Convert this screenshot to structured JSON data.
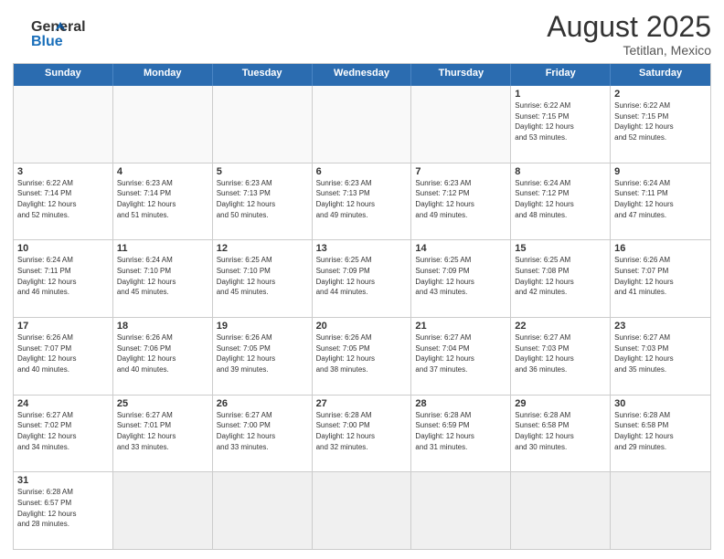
{
  "header": {
    "logo_general": "General",
    "logo_blue": "Blue",
    "month_year": "August 2025",
    "location": "Tetitlan, Mexico"
  },
  "days_of_week": [
    "Sunday",
    "Monday",
    "Tuesday",
    "Wednesday",
    "Thursday",
    "Friday",
    "Saturday"
  ],
  "weeks": [
    [
      {
        "day": "",
        "info": ""
      },
      {
        "day": "",
        "info": ""
      },
      {
        "day": "",
        "info": ""
      },
      {
        "day": "",
        "info": ""
      },
      {
        "day": "",
        "info": ""
      },
      {
        "day": "1",
        "info": "Sunrise: 6:22 AM\nSunset: 7:15 PM\nDaylight: 12 hours\nand 53 minutes."
      },
      {
        "day": "2",
        "info": "Sunrise: 6:22 AM\nSunset: 7:15 PM\nDaylight: 12 hours\nand 52 minutes."
      }
    ],
    [
      {
        "day": "3",
        "info": "Sunrise: 6:22 AM\nSunset: 7:14 PM\nDaylight: 12 hours\nand 52 minutes."
      },
      {
        "day": "4",
        "info": "Sunrise: 6:23 AM\nSunset: 7:14 PM\nDaylight: 12 hours\nand 51 minutes."
      },
      {
        "day": "5",
        "info": "Sunrise: 6:23 AM\nSunset: 7:13 PM\nDaylight: 12 hours\nand 50 minutes."
      },
      {
        "day": "6",
        "info": "Sunrise: 6:23 AM\nSunset: 7:13 PM\nDaylight: 12 hours\nand 49 minutes."
      },
      {
        "day": "7",
        "info": "Sunrise: 6:23 AM\nSunset: 7:12 PM\nDaylight: 12 hours\nand 49 minutes."
      },
      {
        "day": "8",
        "info": "Sunrise: 6:24 AM\nSunset: 7:12 PM\nDaylight: 12 hours\nand 48 minutes."
      },
      {
        "day": "9",
        "info": "Sunrise: 6:24 AM\nSunset: 7:11 PM\nDaylight: 12 hours\nand 47 minutes."
      }
    ],
    [
      {
        "day": "10",
        "info": "Sunrise: 6:24 AM\nSunset: 7:11 PM\nDaylight: 12 hours\nand 46 minutes."
      },
      {
        "day": "11",
        "info": "Sunrise: 6:24 AM\nSunset: 7:10 PM\nDaylight: 12 hours\nand 45 minutes."
      },
      {
        "day": "12",
        "info": "Sunrise: 6:25 AM\nSunset: 7:10 PM\nDaylight: 12 hours\nand 45 minutes."
      },
      {
        "day": "13",
        "info": "Sunrise: 6:25 AM\nSunset: 7:09 PM\nDaylight: 12 hours\nand 44 minutes."
      },
      {
        "day": "14",
        "info": "Sunrise: 6:25 AM\nSunset: 7:09 PM\nDaylight: 12 hours\nand 43 minutes."
      },
      {
        "day": "15",
        "info": "Sunrise: 6:25 AM\nSunset: 7:08 PM\nDaylight: 12 hours\nand 42 minutes."
      },
      {
        "day": "16",
        "info": "Sunrise: 6:26 AM\nSunset: 7:07 PM\nDaylight: 12 hours\nand 41 minutes."
      }
    ],
    [
      {
        "day": "17",
        "info": "Sunrise: 6:26 AM\nSunset: 7:07 PM\nDaylight: 12 hours\nand 40 minutes."
      },
      {
        "day": "18",
        "info": "Sunrise: 6:26 AM\nSunset: 7:06 PM\nDaylight: 12 hours\nand 40 minutes."
      },
      {
        "day": "19",
        "info": "Sunrise: 6:26 AM\nSunset: 7:05 PM\nDaylight: 12 hours\nand 39 minutes."
      },
      {
        "day": "20",
        "info": "Sunrise: 6:26 AM\nSunset: 7:05 PM\nDaylight: 12 hours\nand 38 minutes."
      },
      {
        "day": "21",
        "info": "Sunrise: 6:27 AM\nSunset: 7:04 PM\nDaylight: 12 hours\nand 37 minutes."
      },
      {
        "day": "22",
        "info": "Sunrise: 6:27 AM\nSunset: 7:03 PM\nDaylight: 12 hours\nand 36 minutes."
      },
      {
        "day": "23",
        "info": "Sunrise: 6:27 AM\nSunset: 7:03 PM\nDaylight: 12 hours\nand 35 minutes."
      }
    ],
    [
      {
        "day": "24",
        "info": "Sunrise: 6:27 AM\nSunset: 7:02 PM\nDaylight: 12 hours\nand 34 minutes."
      },
      {
        "day": "25",
        "info": "Sunrise: 6:27 AM\nSunset: 7:01 PM\nDaylight: 12 hours\nand 33 minutes."
      },
      {
        "day": "26",
        "info": "Sunrise: 6:27 AM\nSunset: 7:00 PM\nDaylight: 12 hours\nand 33 minutes."
      },
      {
        "day": "27",
        "info": "Sunrise: 6:28 AM\nSunset: 7:00 PM\nDaylight: 12 hours\nand 32 minutes."
      },
      {
        "day": "28",
        "info": "Sunrise: 6:28 AM\nSunset: 6:59 PM\nDaylight: 12 hours\nand 31 minutes."
      },
      {
        "day": "29",
        "info": "Sunrise: 6:28 AM\nSunset: 6:58 PM\nDaylight: 12 hours\nand 30 minutes."
      },
      {
        "day": "30",
        "info": "Sunrise: 6:28 AM\nSunset: 6:58 PM\nDaylight: 12 hours\nand 29 minutes."
      }
    ],
    [
      {
        "day": "31",
        "info": "Sunrise: 6:28 AM\nSunset: 6:57 PM\nDaylight: 12 hours\nand 28 minutes."
      },
      {
        "day": "",
        "info": ""
      },
      {
        "day": "",
        "info": ""
      },
      {
        "day": "",
        "info": ""
      },
      {
        "day": "",
        "info": ""
      },
      {
        "day": "",
        "info": ""
      },
      {
        "day": "",
        "info": ""
      }
    ]
  ]
}
